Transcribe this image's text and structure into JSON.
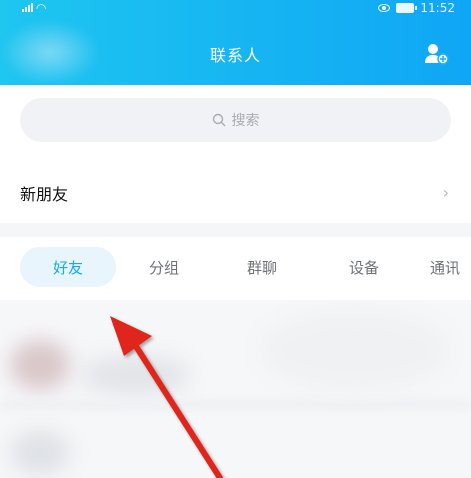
{
  "status_bar": {
    "time": "11:52"
  },
  "header": {
    "title": "联系人"
  },
  "search": {
    "placeholder": "搜索"
  },
  "new_friends": {
    "label": "新朋友",
    "chevron": "›"
  },
  "tabs": [
    {
      "label": "好友",
      "active": true
    },
    {
      "label": "分组"
    },
    {
      "label": "群聊"
    },
    {
      "label": "设备"
    },
    {
      "label": "通讯"
    }
  ],
  "colors": {
    "accent": "#18a9f2",
    "header_gradient_start": "#1ec6f0",
    "header_gradient_end": "#0fa6f5",
    "annotation_arrow": "#e0251b"
  },
  "icons": {
    "status_right": [
      "eye-icon",
      "battery-icon"
    ],
    "header_action": "add-contact-icon",
    "search": "search-icon"
  }
}
